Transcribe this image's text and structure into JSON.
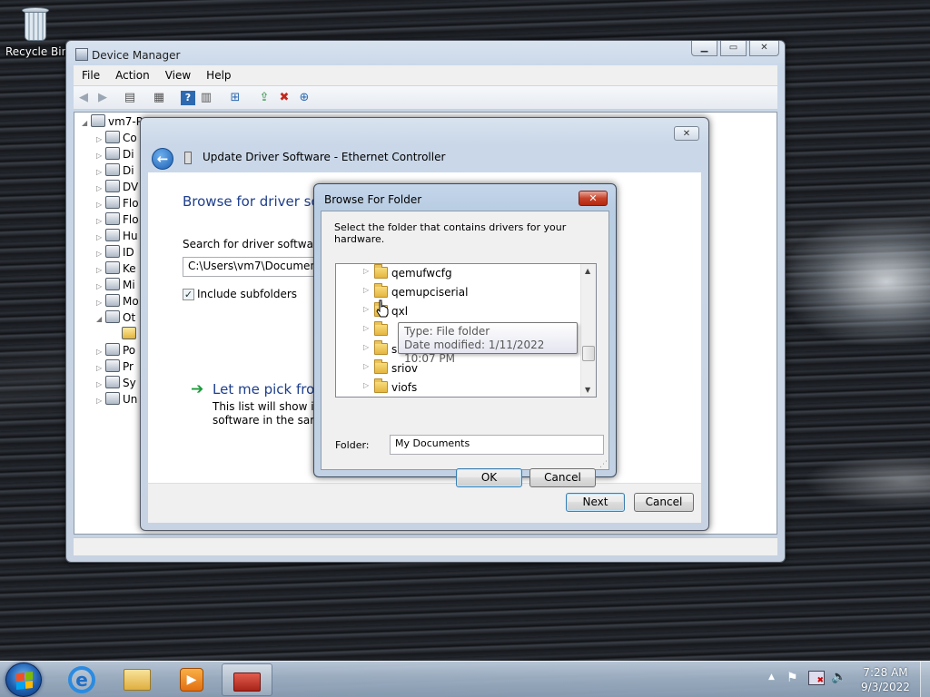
{
  "desktop": {
    "recycle_bin_label": "Recycle Bin"
  },
  "device_manager": {
    "title": "Device Manager",
    "menu": [
      "File",
      "Action",
      "View",
      "Help"
    ],
    "tree": {
      "root": "vm7-P",
      "items": [
        "Co",
        "Di",
        "Di",
        "DV",
        "Flo",
        "Flo",
        "Hu",
        "ID",
        "Ke",
        "Mi",
        "Mo",
        "Ot",
        "",
        "Po",
        "Pr",
        "Sy",
        "Un"
      ]
    }
  },
  "wizard": {
    "title": "Update Driver Software - Ethernet Controller",
    "heading": "Browse for driver sof",
    "search_label": "Search for driver software in",
    "path_value": "C:\\Users\\vm7\\Documents",
    "include_subfolders_label": "Include subfolders",
    "pick_heading": "Let me pick from",
    "pick_desc_line1": "This list will show inst",
    "pick_desc_line2": "software in the same",
    "next_label": "Next",
    "cancel_label": "Cancel"
  },
  "browse_dialog": {
    "title": "Browse For Folder",
    "instruction": "Select the folder that contains drivers for your hardware.",
    "folders": [
      "qemufwcfg",
      "qemupciserial",
      "qxl",
      "",
      "smbus",
      "sriov",
      "viofs"
    ],
    "tooltip_line1": "Type: File folder",
    "tooltip_line2": "Date modified: 1/11/2022 10:07 PM",
    "folder_label": "Folder:",
    "folder_value": "My Documents",
    "ok_label": "OK",
    "cancel_label": "Cancel"
  },
  "taskbar": {
    "time": "7:28 AM",
    "date": "9/3/2022"
  },
  "colors": {
    "heading_blue": "#1e3f8c",
    "link_green": "#1b9a3a"
  }
}
